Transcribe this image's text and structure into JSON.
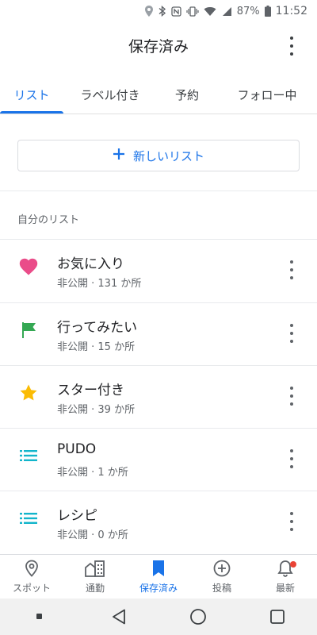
{
  "status_bar": {
    "battery_percent": "87%",
    "time": "11:52"
  },
  "app_bar": {
    "title": "保存済み",
    "more_icon": "more-vert-icon"
  },
  "tabs": [
    {
      "label": "リスト",
      "active": true
    },
    {
      "label": "ラベル付き",
      "active": false
    },
    {
      "label": "予約",
      "active": false
    },
    {
      "label": "フォロー中",
      "active": false
    }
  ],
  "new_list_button": {
    "label": "新しいリスト",
    "icon": "plus-icon"
  },
  "section_label": "自分のリスト",
  "lists": [
    {
      "title": "お気に入り",
      "subtitle": "非公開 · 131 か所",
      "icon": "heart-icon",
      "color": "#ea4c89"
    },
    {
      "title": "行ってみたい",
      "subtitle": "非公開 · 15 か所",
      "icon": "flag-icon",
      "color": "#34a853"
    },
    {
      "title": "スター付き",
      "subtitle": "非公開 · 39 か所",
      "icon": "star-icon",
      "color": "#fbbc04"
    },
    {
      "title": "PUDO",
      "subtitle": "非公開 · 1 か所",
      "icon": "list-icon",
      "color": "#12b5cb"
    },
    {
      "title": "レシピ",
      "subtitle": "非公開 · 0 か所",
      "icon": "list-icon",
      "color": "#12b5cb"
    }
  ],
  "bottom_nav": [
    {
      "label": "スポット",
      "icon": "place-icon",
      "active": false
    },
    {
      "label": "通勤",
      "icon": "commute-icon",
      "active": false
    },
    {
      "label": "保存済み",
      "icon": "bookmark-icon",
      "active": true
    },
    {
      "label": "投稿",
      "icon": "add-circle-icon",
      "active": false
    },
    {
      "label": "最新",
      "icon": "bell-icon",
      "active": false,
      "badge": true
    }
  ],
  "colors": {
    "accent": "#1a73e8",
    "badge": "#ea4335"
  }
}
